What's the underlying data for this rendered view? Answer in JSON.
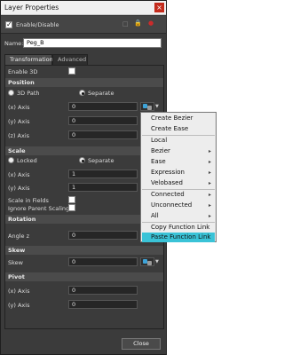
{
  "window": {
    "title": "Layer Properties",
    "close_glyph": "×"
  },
  "layer": {
    "enable_label": "Enable/Disable",
    "enabled": true,
    "name_label": "Name:",
    "name_value": "Peg_B"
  },
  "tabs": [
    {
      "label": "Transformation",
      "active": true
    },
    {
      "label": "Advanced",
      "active": false
    }
  ],
  "enable3d": {
    "label": "Enable 3D",
    "checked": false
  },
  "position": {
    "header": "Position",
    "mode_3dpath": "3D Path",
    "mode_separate": "Separate",
    "selected_mode": "Separate",
    "x_label": "(x) Axis",
    "x_value": "0",
    "y_label": "(y) Axis",
    "y_value": "0",
    "z_label": "(z) Axis",
    "z_value": "0"
  },
  "scale": {
    "header": "Scale",
    "mode_locked": "Locked",
    "mode_separate": "Separate",
    "selected_mode": "Separate",
    "x_label": "(x) Axis",
    "x_value": "1",
    "y_label": "(y) Axis",
    "y_value": "1",
    "in_fields_label": "Scale in Fields",
    "ignore_parent_label": "Ignore Parent Scaling"
  },
  "rotation": {
    "header": "Rotation",
    "angle_label": "Angle z",
    "angle_value": "0"
  },
  "skew": {
    "header": "Skew",
    "label": "Skew",
    "value": "0"
  },
  "pivot": {
    "header": "Pivot",
    "x_label": "(x) Axis",
    "x_value": "0",
    "y_label": "(y) Axis",
    "y_value": "0"
  },
  "footer": {
    "close_label": "Close"
  },
  "context_menu": {
    "items": [
      {
        "label": "Create Bezier",
        "submenu": false
      },
      {
        "label": "Create Ease",
        "submenu": false
      },
      {
        "label": "Local",
        "submenu": false
      },
      {
        "label": "Bezier",
        "submenu": true
      },
      {
        "label": "Ease",
        "submenu": true
      },
      {
        "label": "Expression",
        "submenu": true
      },
      {
        "label": "Velobased",
        "submenu": true
      },
      {
        "label": "Connected",
        "submenu": true
      },
      {
        "label": "Unconnected",
        "submenu": true
      },
      {
        "label": "All",
        "submenu": true
      },
      {
        "label": "Copy Function Link",
        "submenu": false
      },
      {
        "label": "Paste Function Link",
        "submenu": false,
        "highlighted": true
      }
    ],
    "submenu_glyph": "▸",
    "highlight_color": "#3ac3d7"
  },
  "icons": {
    "title_close": "close-icon",
    "function_button": "function-link-icon",
    "dropdown": "chevron-down-icon"
  },
  "colors": {
    "panel_bg": "#3b3b3b",
    "field_bg": "#262626",
    "menu_bg": "#ededed",
    "close_red": "#c42b1c"
  }
}
